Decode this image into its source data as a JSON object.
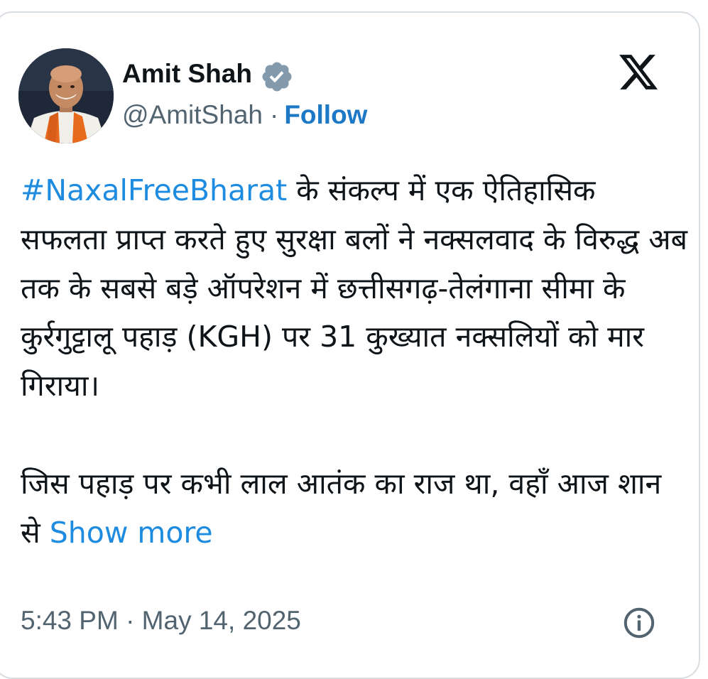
{
  "author": {
    "display_name": "Amit Shah",
    "handle": "@AmitShah",
    "verified": true,
    "avatar_icon": "profile-photo"
  },
  "header": {
    "separator": "·",
    "follow_label": "Follow",
    "brand_icon": "x-logo-icon"
  },
  "tweet": {
    "hashtag": "#NaxalFreeBharat",
    "paragraph1_text": " के संकल्प में एक ऐतिहासिक सफलता प्राप्त करते हुए सुरक्षा बलों ने नक्सलवाद के विरुद्ध अब तक के सबसे बड़े ऑपरेशन में छत्तीसगढ़-तेलंगाना सीमा के कुर्रगुट्टालू पहाड़ (KGH) पर 31 कुख्यात नक्सलियों को मार गिराया।",
    "paragraph2_text": "जिस पहाड़ पर कभी लाल आतंक का राज था, वहाँ आज शान से ",
    "show_more_label": "Show more"
  },
  "footer": {
    "timestamp": "5:43 PM · May 14, 2025",
    "info_icon": "info-icon"
  },
  "colors": {
    "link_blue": "#1d8ce0",
    "follow_blue": "#1d79c6",
    "secondary_text": "#536471",
    "primary_text": "#0f1419",
    "verified_gray": "#829aab"
  }
}
